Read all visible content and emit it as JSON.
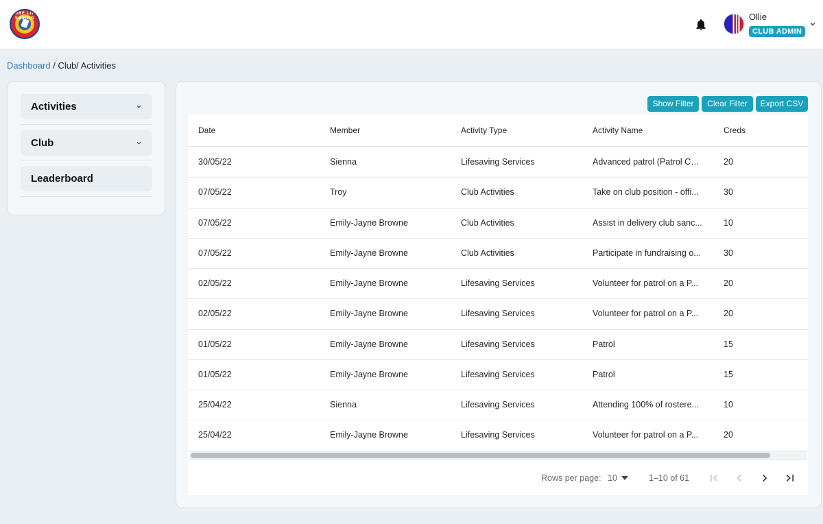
{
  "header": {
    "logo_text": "SURF LIFE SAVING",
    "user_name": "Ollie",
    "user_role": "CLUB ADMIN"
  },
  "breadcrumb": {
    "link": "Dashboard",
    "rest": " / Club/ Activities"
  },
  "sidebar": {
    "items": [
      {
        "label": "Activities",
        "expandable": true
      },
      {
        "label": "Club",
        "expandable": true
      },
      {
        "label": "Leaderboard",
        "expandable": false
      }
    ]
  },
  "toolbar": {
    "show_filter": "Show Filter",
    "clear_filter": "Clear Filter",
    "export_csv": "Export CSV"
  },
  "table": {
    "columns": [
      "Date",
      "Member",
      "Activity Type",
      "Activity Name",
      "Creds"
    ],
    "rows": [
      {
        "date": "30/05/22",
        "member": "Sienna",
        "type": "Lifesaving Services",
        "name": "Advanced patrol (Patrol Ca...",
        "creds": "20"
      },
      {
        "date": "07/05/22",
        "member": "Troy",
        "type": "Club Activities",
        "name": "Take on club position - offi...",
        "creds": "30"
      },
      {
        "date": "07/05/22",
        "member": "Emily-Jayne Browne",
        "type": "Club Activities",
        "name": "Assist in delivery club sanc...",
        "creds": "10"
      },
      {
        "date": "07/05/22",
        "member": "Emily-Jayne Browne",
        "type": "Club Activities",
        "name": "Participate in fundraising o...",
        "creds": "30"
      },
      {
        "date": "02/05/22",
        "member": "Emily-Jayne Browne",
        "type": "Lifesaving Services",
        "name": "Volunteer for patrol on a P...",
        "creds": "20"
      },
      {
        "date": "02/05/22",
        "member": "Emily-Jayne Browne",
        "type": "Lifesaving Services",
        "name": "Volunteer for patrol on a P...",
        "creds": "20"
      },
      {
        "date": "01/05/22",
        "member": "Emily-Jayne Browne",
        "type": "Lifesaving Services",
        "name": "Patrol",
        "creds": "15"
      },
      {
        "date": "01/05/22",
        "member": "Emily-Jayne Browne",
        "type": "Lifesaving Services",
        "name": "Patrol",
        "creds": "15"
      },
      {
        "date": "25/04/22",
        "member": "Sienna",
        "type": "Lifesaving Services",
        "name": "Attending 100% of rostere...",
        "creds": "10"
      },
      {
        "date": "25/04/22",
        "member": "Emily-Jayne Browne",
        "type": "Lifesaving Services",
        "name": "Volunteer for patrol on a P...",
        "creds": "20"
      }
    ]
  },
  "pagination": {
    "rows_per_page_label": "Rows per page:",
    "rows_per_page": "10",
    "range": "1–10 of 61",
    "first_enabled": false,
    "prev_enabled": false,
    "next_enabled": true,
    "last_enabled": true
  },
  "colors": {
    "accent": "#1aa2bd",
    "link": "#2f7fc4",
    "background": "#eaeff4"
  },
  "icons": [
    "notifications-bell-icon",
    "chevron-down-icon",
    "first-page-icon",
    "previous-page-icon",
    "next-page-icon",
    "last-page-icon"
  ]
}
